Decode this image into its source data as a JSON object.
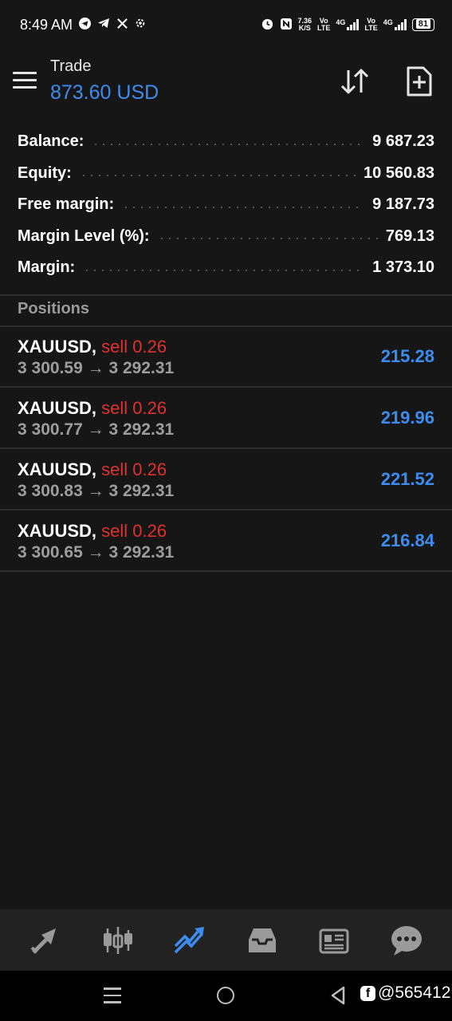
{
  "status_bar": {
    "time": "8:49 AM",
    "net_speed_value": "7.36",
    "net_speed_unit": "K/S",
    "sim1_label_top": "Vo",
    "sim1_label_bottom": "LTE",
    "sim1_net": "4G",
    "sim2_label_top": "Vo",
    "sim2_label_bottom": "LTE",
    "sim2_net": "4G",
    "battery": "81",
    "icons": [
      "telegram-icon",
      "telegram-icon",
      "x-icon",
      "settings-icon",
      "alarm-icon",
      "nfc-icon"
    ]
  },
  "header": {
    "title": "Trade",
    "profit": "873.60 USD",
    "profit_color": "#3d8cf0"
  },
  "summary": [
    {
      "label": "Balance:",
      "value": "9 687.23"
    },
    {
      "label": "Equity:",
      "value": "10 560.83"
    },
    {
      "label": "Free margin:",
      "value": "9 187.73"
    },
    {
      "label": "Margin Level (%):",
      "value": "769.13"
    },
    {
      "label": "Margin:",
      "value": "1 373.10"
    }
  ],
  "positions_header": "Positions",
  "positions": [
    {
      "symbol": "XAUUSD,",
      "side": "sell 0.26",
      "open": "3 300.59",
      "arrow": "→",
      "current": "3 292.31",
      "profit": "215.28"
    },
    {
      "symbol": "XAUUSD,",
      "side": "sell 0.26",
      "open": "3 300.77",
      "arrow": "→",
      "current": "3 292.31",
      "profit": "219.96"
    },
    {
      "symbol": "XAUUSD,",
      "side": "sell 0.26",
      "open": "3 300.83",
      "arrow": "→",
      "current": "3 292.31",
      "profit": "221.52"
    },
    {
      "symbol": "XAUUSD,",
      "side": "sell 0.26",
      "open": "3 300.65",
      "arrow": "→",
      "current": "3 292.31",
      "profit": "216.84"
    }
  ],
  "bottom_nav": {
    "items": [
      "quotes-icon",
      "chart-icon",
      "trade-icon",
      "history-icon",
      "news-icon",
      "messages-icon"
    ],
    "active": "trade-icon",
    "active_color": "#3d8cf0",
    "inactive_color": "#9a9a9a"
  },
  "watermark": "@565412",
  "colors": {
    "sell": "#e0312e",
    "profit": "#3d8cf0",
    "background": "#161616"
  }
}
